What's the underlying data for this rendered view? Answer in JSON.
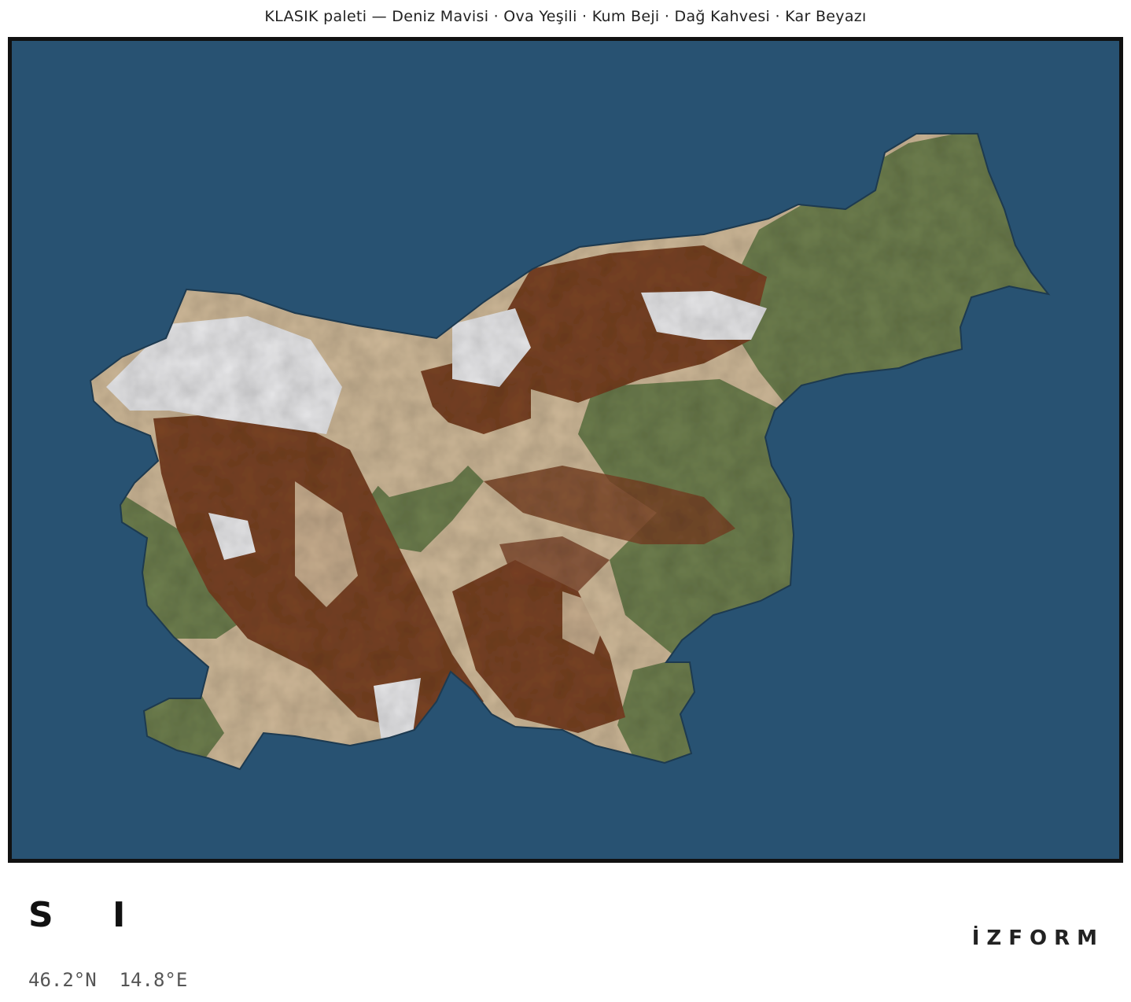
{
  "caption": "KLASIK paleti — Deniz Mavisi · Ova Yeşili · Kum Beji · Dağ Kahvesi · Kar Beyazı",
  "palette": {
    "name": "KLASIK",
    "classes": [
      {
        "label": "Deniz Mavisi",
        "color": "#285272"
      },
      {
        "label": "Ova Yeşili",
        "color": "#6e7f4f"
      },
      {
        "label": "Kum Beji",
        "color": "#cfb999"
      },
      {
        "label": "Dağ Kahvesi",
        "color": "#7a4428"
      },
      {
        "label": "Kar Beyazı",
        "color": "#e8e8ea"
      }
    ]
  },
  "map": {
    "country_code": "S I",
    "coordinates": "46.2°N  14.8°E",
    "frame_color": "#111111"
  },
  "brand": "İZFORM"
}
